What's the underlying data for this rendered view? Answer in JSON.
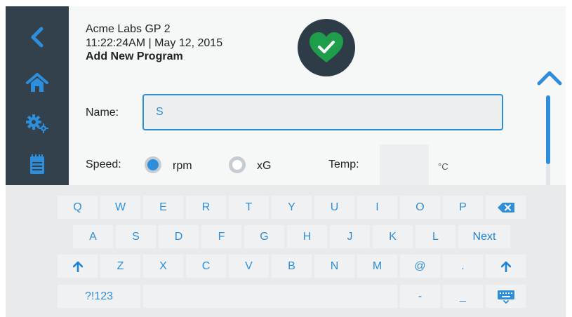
{
  "header": {
    "device_name": "Acme Labs GP 2",
    "datetime": "11:22:24AM | May 12, 2015",
    "page_title": "Add New Program"
  },
  "sidebar": {
    "items": [
      {
        "icon": "back-arrow-icon"
      },
      {
        "icon": "home-icon"
      },
      {
        "icon": "gears-icon"
      },
      {
        "icon": "notepad-icon"
      }
    ]
  },
  "status": {
    "icon": "heart-check-icon",
    "color": "#1e9e4a"
  },
  "form": {
    "name_label": "Name:",
    "name_value": "S",
    "speed_label": "Speed:",
    "speed_options": [
      {
        "label": "rpm",
        "selected": true
      },
      {
        "label": "xG",
        "selected": false
      }
    ],
    "temp_label": "Temp:",
    "temp_value": "",
    "temp_unit": "°C"
  },
  "scroll": {
    "up_icon": "chevron-up-icon"
  },
  "keyboard": {
    "row1": [
      "Q",
      "W",
      "E",
      "R",
      "T",
      "Y",
      "U",
      "I",
      "O",
      "P"
    ],
    "row1_backspace_icon": "backspace-icon",
    "row2": [
      "A",
      "S",
      "D",
      "F",
      "G",
      "H",
      "J",
      "K",
      "L"
    ],
    "row2_next": "Next",
    "row3_shift_icon": "shift-arrow-icon",
    "row3": [
      "Z",
      "X",
      "C",
      "V",
      "B",
      "N",
      "M",
      "@",
      "."
    ],
    "row4_symbols": "?!123",
    "row4_dash": "-",
    "row4_underscore": "_",
    "row4_hide_icon": "keyboard-hide-icon"
  },
  "colors": {
    "accent": "#2d8fdc",
    "sidebar": "#33414d",
    "status_bg": "#2e3c47",
    "ok_green": "#1e9e4a"
  }
}
